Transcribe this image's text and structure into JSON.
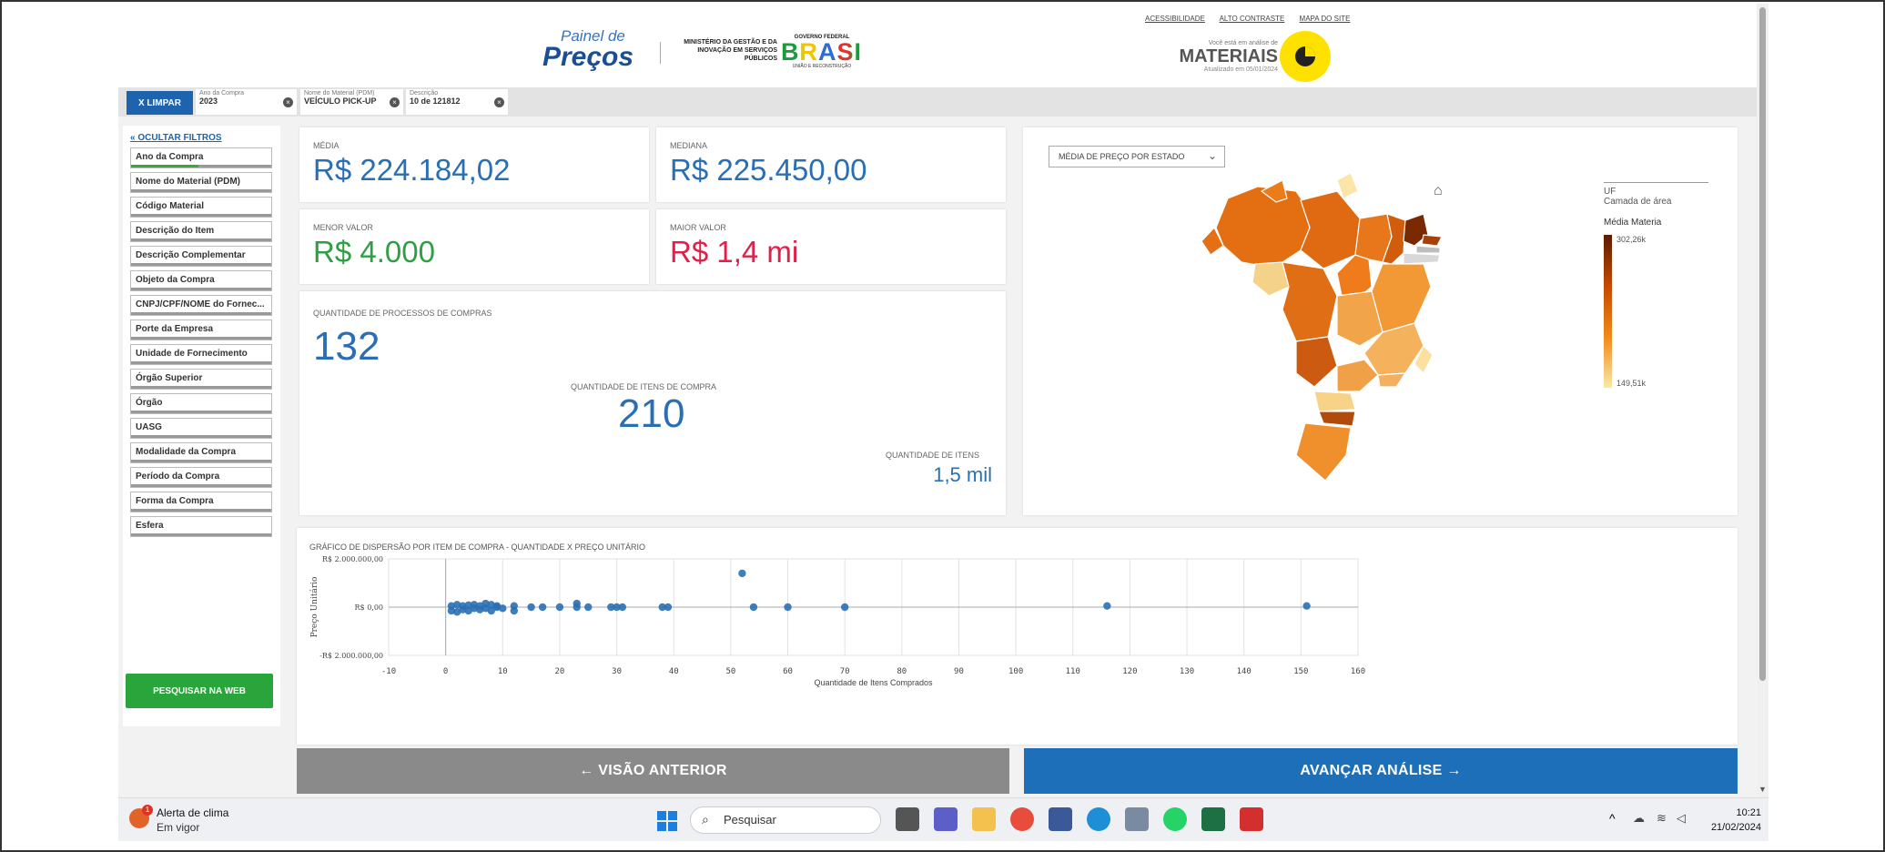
{
  "header": {
    "logo_line1": "Painel de",
    "logo_line2": "Preços",
    "ministerio": "MINISTÉRIO DA GESTÃO E DA INOVAÇÃO EM SERVIÇOS PÚBLICOS",
    "gov_top": "GOVERNO FEDERAL",
    "gov_brand": "BRASIL",
    "gov_bottom": "UNIÃO E RECONSTRUÇÃO",
    "links": [
      "ACESSIBILIDADE",
      "ALTO CONTRASTE",
      "MAPA DO SITE"
    ],
    "analysis_label": "Você está em análise de",
    "analysis_title": "MATERIAIS",
    "updated": "Atualizado em 05/01/2024"
  },
  "filterbar": {
    "clear_label": "X  LIMPAR",
    "chips": [
      {
        "label": "Ano da Compra",
        "value": "2023"
      },
      {
        "label": "Nome do Material (PDM)",
        "value": "VEÍCULO PICK-UP"
      },
      {
        "label": "Descrição",
        "value": "10 de 121812"
      }
    ]
  },
  "sidebar": {
    "hide_filters": "OCULTAR FILTROS",
    "items": [
      "Ano da Compra",
      "Nome do Material (PDM)",
      "Código Material",
      "Descrição do Item",
      "Descrição Complementar",
      "Objeto da Compra",
      "CNPJ/CPF/NOME do Fornec...",
      "Porte da Empresa",
      "Unidade de Fornecimento",
      "Órgão Superior",
      "Órgão",
      "UASG",
      "Modalidade da Compra",
      "Período da Compra",
      "Forma da Compra",
      "Esfera"
    ],
    "search_web": "PESQUISAR NA WEB"
  },
  "kpis": {
    "media_label": "MÉDIA",
    "media_value": "R$ 224.184,02",
    "mediana_label": "MEDIANA",
    "mediana_value": "R$ 225.450,00",
    "menor_label": "MENOR VALOR",
    "menor_value": "R$ 4.000",
    "maior_label": "MAIOR VALOR",
    "maior_value": "R$ 1,4 mi",
    "processos_label": "QUANTIDADE DE PROCESSOS DE COMPRAS",
    "processos_value": "132",
    "itens_compra_label": "QUANTIDADE DE ITENS DE COMPRA",
    "itens_compra_value": "210",
    "itens_label": "QUANTIDADE DE ITENS",
    "itens_value": "1,5 mil"
  },
  "map": {
    "select_label": "MÉDIA DE PREÇO POR ESTADO",
    "legend_title": "UF",
    "legend_layer": "Camada de área",
    "legend_metric": "Média Materia",
    "legend_max": "302,26k",
    "legend_min": "149,51k"
  },
  "chart_data": {
    "type": "scatter",
    "title": "GRÁFICO DE DISPERSÃO POR ITEM DE COMPRA - QUANTIDADE X PREÇO UNITÁRIO",
    "xlabel": "Quantidade de Itens Comprados",
    "ylabel": "Preço Unitário",
    "xlim": [
      -10,
      160
    ],
    "ylim": [
      -2000000,
      2000000
    ],
    "x_ticks": [
      "-10",
      "0",
      "10",
      "20",
      "30",
      "40",
      "50",
      "60",
      "70",
      "80",
      "90",
      "100",
      "110",
      "120",
      "130",
      "140",
      "150",
      "160"
    ],
    "y_ticks": [
      "R$ 2.000.000,00",
      "R$ 0,00",
      "-R$ 2.000.000,00"
    ],
    "points": [
      {
        "x": 1,
        "y": 50000
      },
      {
        "x": 1,
        "y": -150000
      },
      {
        "x": 2,
        "y": 100000
      },
      {
        "x": 2,
        "y": -200000
      },
      {
        "x": 3,
        "y": 50000
      },
      {
        "x": 3,
        "y": -100000
      },
      {
        "x": 4,
        "y": 80000
      },
      {
        "x": 4,
        "y": -150000
      },
      {
        "x": 5,
        "y": 100000
      },
      {
        "x": 5,
        "y": -50000
      },
      {
        "x": 6,
        "y": -100000
      },
      {
        "x": 6,
        "y": 50000
      },
      {
        "x": 7,
        "y": 150000
      },
      {
        "x": 7,
        "y": -50000
      },
      {
        "x": 8,
        "y": -150000
      },
      {
        "x": 8,
        "y": 100000
      },
      {
        "x": 9,
        "y": 0
      },
      {
        "x": 9,
        "y": 50000
      },
      {
        "x": 10,
        "y": -50000
      },
      {
        "x": 12,
        "y": 50000
      },
      {
        "x": 12,
        "y": -150000
      },
      {
        "x": 15,
        "y": 0
      },
      {
        "x": 17,
        "y": 0
      },
      {
        "x": 20,
        "y": 0
      },
      {
        "x": 23,
        "y": 150000
      },
      {
        "x": 23,
        "y": 0
      },
      {
        "x": 25,
        "y": 0
      },
      {
        "x": 29,
        "y": 0
      },
      {
        "x": 30,
        "y": 0
      },
      {
        "x": 31,
        "y": 0
      },
      {
        "x": 38,
        "y": 0
      },
      {
        "x": 39,
        "y": 0
      },
      {
        "x": 52,
        "y": 1400000
      },
      {
        "x": 54,
        "y": 0
      },
      {
        "x": 60,
        "y": 0
      },
      {
        "x": 70,
        "y": 0
      },
      {
        "x": 116,
        "y": 50000
      },
      {
        "x": 151,
        "y": 50000
      }
    ],
    "color": "#2a6fb4"
  },
  "nav": {
    "back": "←  VISÃO ANTERIOR",
    "forward": "AVANÇAR ANÁLISE  →"
  },
  "taskbar": {
    "alert_title": "Alerta de clima",
    "alert_sub": "Em vigor",
    "search_placeholder": "Pesquisar",
    "time": "10:21",
    "date": "21/02/2024"
  }
}
